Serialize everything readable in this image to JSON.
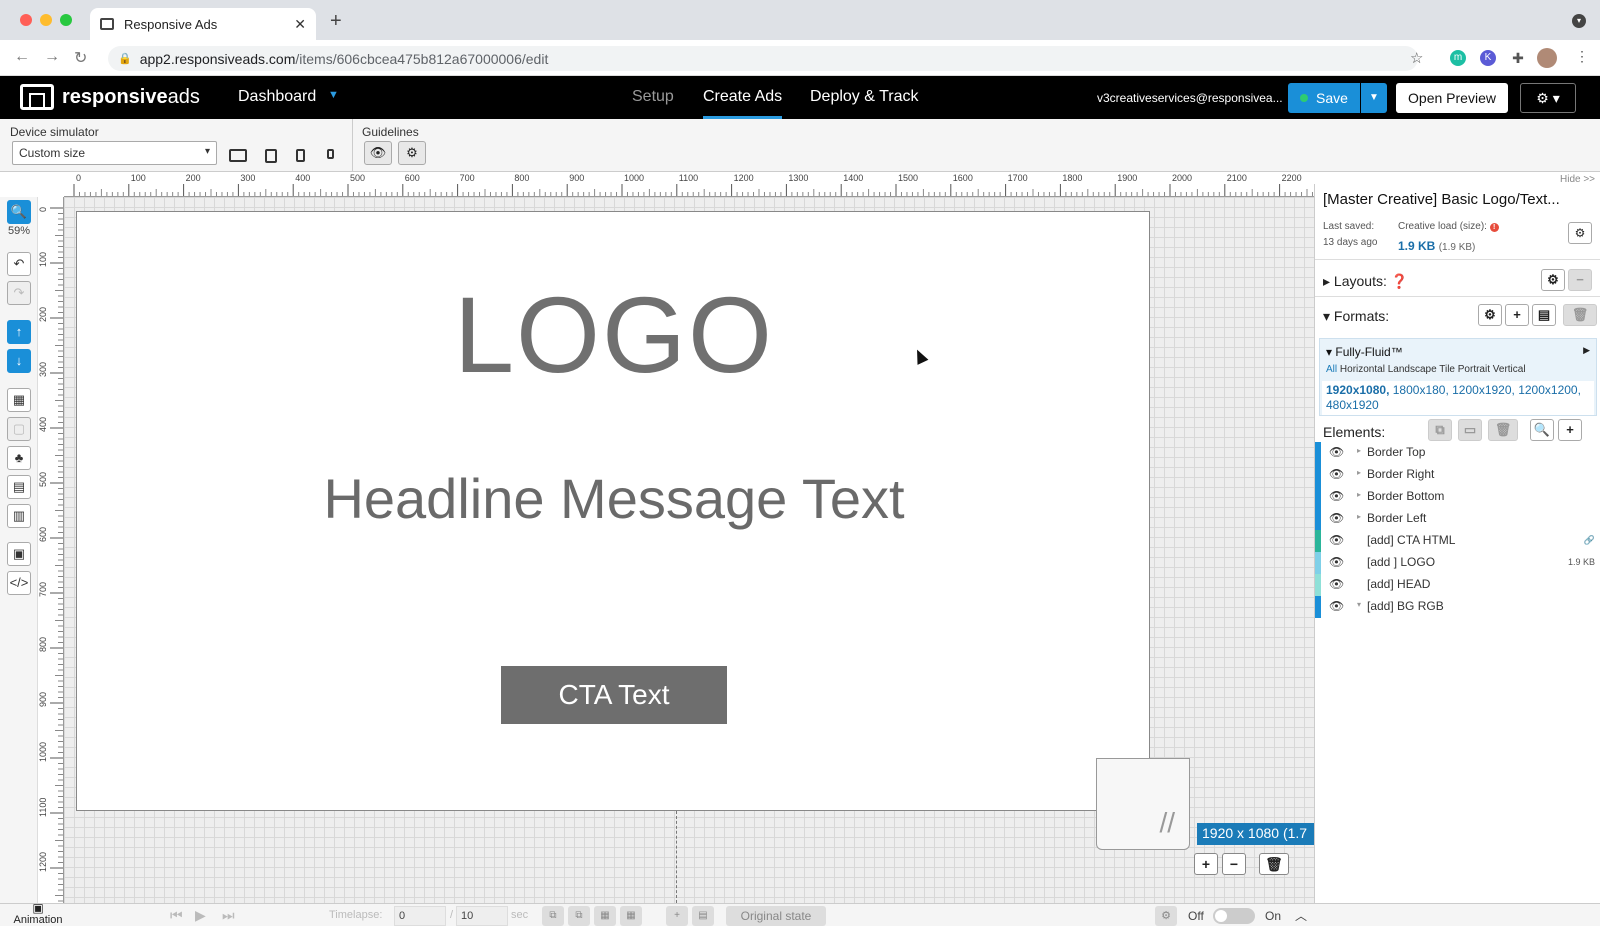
{
  "browser": {
    "tab_title": "Responsive Ads",
    "url_host": "app2.responsiveads.com",
    "url_path": "/items/606cbcea475b812a67000006/edit"
  },
  "header": {
    "brand_bold": "responsive",
    "brand_thin": "ads",
    "dashboard_label": "Dashboard",
    "tabs": [
      {
        "label": "Setup",
        "state": "inactive"
      },
      {
        "label": "Create Ads",
        "state": "active"
      },
      {
        "label": "Deploy & Track",
        "state": "normal"
      }
    ],
    "email": "v3creativeservices@responsivea...",
    "save_label": "Save",
    "preview_label": "Open Preview",
    "accent_color": "#1a8fd8"
  },
  "toolbar": {
    "device_label": "Device simulator",
    "device_value": "Custom size",
    "guidelines_label": "Guidelines"
  },
  "ruler": {
    "ticks": [
      "0",
      "100",
      "200",
      "300",
      "400",
      "500",
      "600",
      "700",
      "800",
      "900",
      "1000",
      "1100",
      "1200",
      "1300",
      "1400",
      "1500",
      "1600",
      "1700",
      "1800",
      "1900",
      "2000",
      "2100",
      "2200"
    ],
    "vticks": [
      "0",
      "100",
      "200",
      "300",
      "400",
      "500",
      "600",
      "700",
      "800",
      "900",
      "1000",
      "1100",
      "1200"
    ],
    "hide_label": "Hide >>"
  },
  "left_tools": {
    "zoom": "59%"
  },
  "canvas": {
    "logo_text": "LOGO",
    "headline_text": "Headline Message Text",
    "cta_text": "CTA Text",
    "dimensions": "1920 x 1080 (1.7"
  },
  "panel": {
    "title": "[Master Creative] Basic Logo/Text...",
    "last_saved_label": "Last saved:",
    "last_saved_value": "13 days ago",
    "load_label": "Creative load (size):",
    "load_value": "1.9 KB",
    "load_sub": "(1.9 KB)",
    "layouts_label": "Layouts:",
    "formats_label": "Formats:",
    "format_name": "Fully-Fluid™",
    "format_filter_all": "All",
    "format_filters": "Horizontal Landscape Tile Portrait Vertical",
    "format_sizes_bold": "1920x1080,",
    "format_sizes_rest": "1800x180, 1200x1920, 1200x1200, 480x1920",
    "elements_label": "Elements:",
    "elements": [
      {
        "name": "Border Top",
        "meta": "",
        "color": "#1a8fd8",
        "caret": "▸"
      },
      {
        "name": "Border Right",
        "meta": "",
        "color": "#1a8fd8",
        "caret": "▸"
      },
      {
        "name": "Border Bottom",
        "meta": "",
        "color": "#1a8fd8",
        "caret": "▸"
      },
      {
        "name": "Border Left",
        "meta": "",
        "color": "#1a8fd8",
        "caret": "▸"
      },
      {
        "name": "[add] CTA HTML",
        "meta": "🔗",
        "color": "#2bb59a",
        "caret": ""
      },
      {
        "name": "[add ] LOGO",
        "meta": "1.9 KB",
        "color": "#7fd0e8",
        "caret": ""
      },
      {
        "name": "[add] HEAD",
        "meta": "",
        "color": "#8fe0d8",
        "caret": ""
      },
      {
        "name": "[add] BG RGB",
        "meta": "",
        "color": "#1a8fd8",
        "caret": "▾"
      }
    ]
  },
  "bottom": {
    "animation_label": "Animation",
    "timelapse_label": "Timelapse:",
    "time_value": "0",
    "time_total": "10",
    "sec_label": "sec",
    "state_label": "Original state",
    "off_label": "Off",
    "on_label": "On"
  }
}
